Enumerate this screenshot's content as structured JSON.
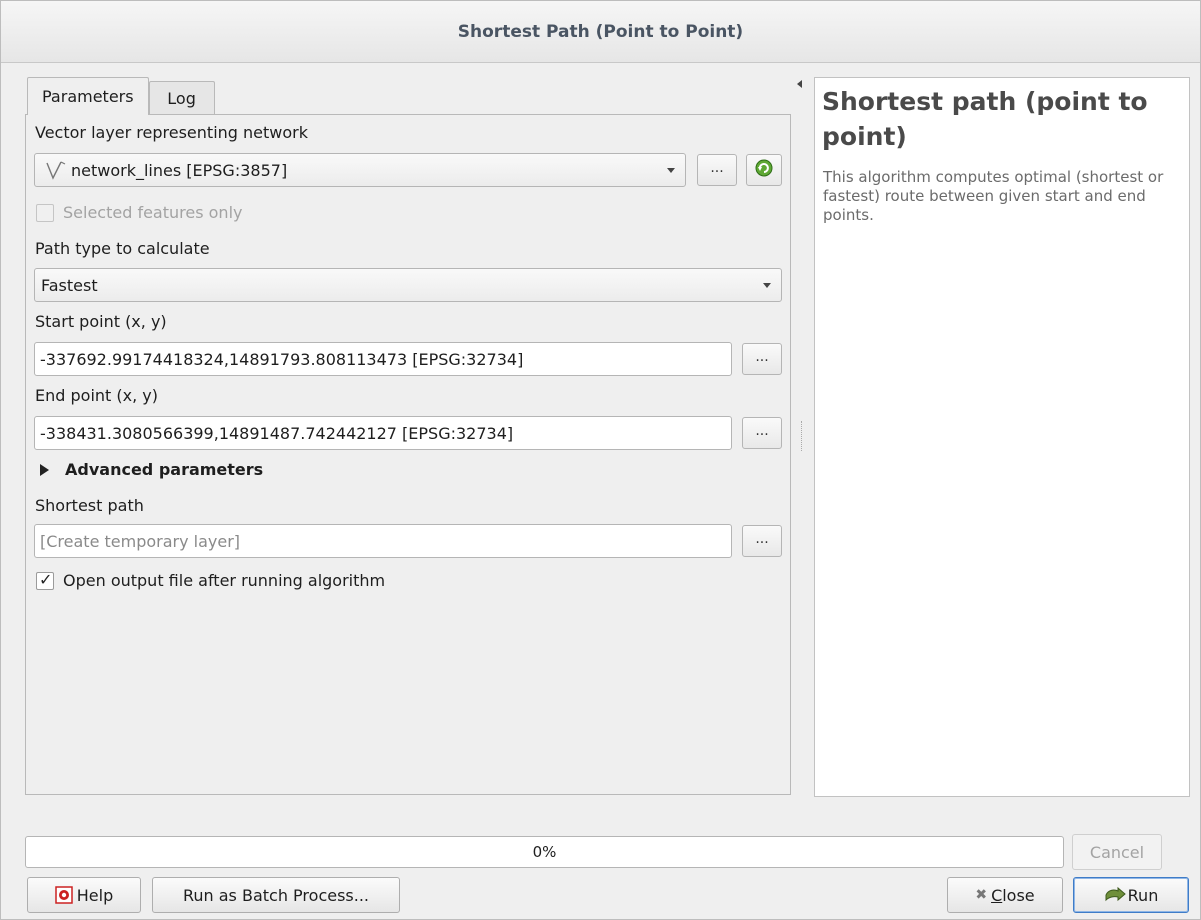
{
  "window": {
    "title": "Shortest Path (Point to Point)"
  },
  "tabs": [
    {
      "label": "Parameters",
      "active": true
    },
    {
      "label": "Log",
      "active": false
    }
  ],
  "params": {
    "network_label": "Vector layer representing network",
    "network_value": "network_lines [EPSG:3857]",
    "browse_label": "...",
    "selected_only_label": "Selected features only",
    "selected_only_checked": false,
    "path_type_label": "Path type to calculate",
    "path_type_value": "Fastest",
    "start_label": "Start point (x, y)",
    "start_value": "-337692.99174418324,14891793.808113473 [EPSG:32734]",
    "end_label": "End point (x, y)",
    "end_value": "-338431.3080566399,14891487.742442127 [EPSG:32734]",
    "advanced_label": "Advanced parameters",
    "output_label": "Shortest path",
    "output_placeholder": "[Create temporary layer]",
    "open_output_label": "Open output file after running algorithm",
    "open_output_checked": true
  },
  "help": {
    "title": "Shortest path (point to point)",
    "description": "This algorithm computes optimal (shortest or fastest) route between given start and end points."
  },
  "progress": {
    "value": 0,
    "text": "0%"
  },
  "buttons": {
    "help": "Help",
    "batch": "Run as Batch Process...",
    "cancel": "Cancel",
    "close": "Close",
    "run": "Run"
  }
}
